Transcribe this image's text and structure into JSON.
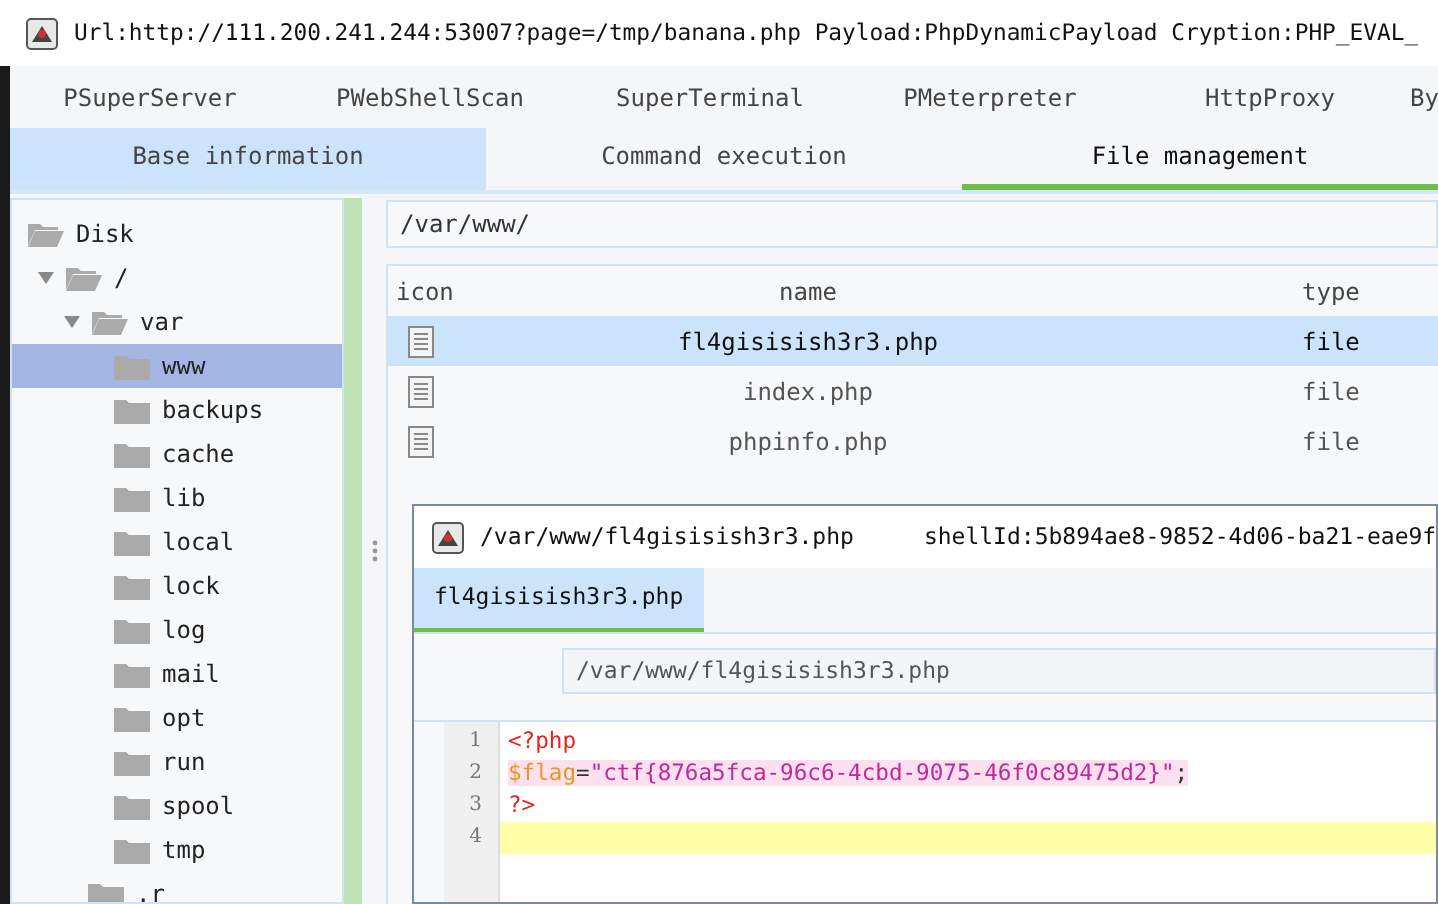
{
  "window": {
    "title": "Url:http://111.200.241.244:53007?page=/tmp/banana.php Payload:PhpDynamicPayload Cryption:PHP_EVAL_"
  },
  "plugin_tabs": [
    {
      "label": "PSuperServer",
      "selected": false
    },
    {
      "label": "PWebShellScan",
      "selected": false
    },
    {
      "label": "SuperTerminal",
      "selected": false
    },
    {
      "label": "PMeterpreter",
      "selected": false
    },
    {
      "label": "HttpProxy",
      "selected": false
    },
    {
      "label": "By",
      "selected": false
    }
  ],
  "tabs": [
    {
      "label": "Base information",
      "selected": false,
      "highlighted": true
    },
    {
      "label": "Command execution",
      "selected": false,
      "highlighted": false
    },
    {
      "label": "File management",
      "selected": true,
      "highlighted": false
    }
  ],
  "tree": [
    {
      "label": "Disk",
      "selected": false,
      "children": [
        {
          "label": "/",
          "selected": false,
          "expanded": true,
          "children": [
            {
              "label": "var",
              "selected": false,
              "expanded": true,
              "children": [
                {
                  "label": "www",
                  "selected": true
                },
                {
                  "label": "backups",
                  "selected": false
                },
                {
                  "label": "cache",
                  "selected": false
                },
                {
                  "label": "lib",
                  "selected": false
                },
                {
                  "label": "local",
                  "selected": false
                },
                {
                  "label": "lock",
                  "selected": false
                },
                {
                  "label": "log",
                  "selected": false
                },
                {
                  "label": "mail",
                  "selected": false
                },
                {
                  "label": "opt",
                  "selected": false
                },
                {
                  "label": "run",
                  "selected": false
                },
                {
                  "label": "spool",
                  "selected": false
                },
                {
                  "label": "tmp",
                  "selected": false
                }
              ]
            },
            {
              "label": ".r",
              "selected": false
            }
          ]
        }
      ]
    }
  ],
  "path_field": {
    "value": "/var/www/"
  },
  "table": {
    "columns": [
      "icon",
      "name",
      "type"
    ],
    "rows": [
      {
        "name": "fl4gisisish3r3.php",
        "type": "file",
        "selected": true
      },
      {
        "name": "index.php",
        "type": "file",
        "selected": false
      },
      {
        "name": "phpinfo.php",
        "type": "file",
        "selected": false
      }
    ]
  },
  "editor_window": {
    "title": "/var/www/fl4gisisish3r3.php",
    "shell_id": "shellId:5b894ae8-9852-4d06-ba21-eae9f",
    "tabs": [
      {
        "label": "fl4gisisish3r3.php",
        "selected": true
      }
    ],
    "path_field": {
      "value": "/var/www/fl4gisisish3r3.php"
    },
    "lines": [
      {
        "number": "1",
        "current": false,
        "marked": false,
        "tokens": [
          {
            "text": "<?php",
            "kind": "tag"
          }
        ]
      },
      {
        "number": "2",
        "current": false,
        "marked": true,
        "tokens": [
          {
            "text": "$flag",
            "kind": "variable"
          },
          {
            "text": "=",
            "kind": "operator"
          },
          {
            "text": "\"ctf{876a5fca-96c6-4cbd-9075-46f0c89475d2}\"",
            "kind": "string"
          },
          {
            "text": ";",
            "kind": "operator"
          }
        ]
      },
      {
        "number": "3",
        "current": false,
        "marked": false,
        "tokens": [
          {
            "text": "?>",
            "kind": "tag"
          }
        ]
      },
      {
        "number": "4",
        "current": true,
        "marked": false
      }
    ]
  }
}
